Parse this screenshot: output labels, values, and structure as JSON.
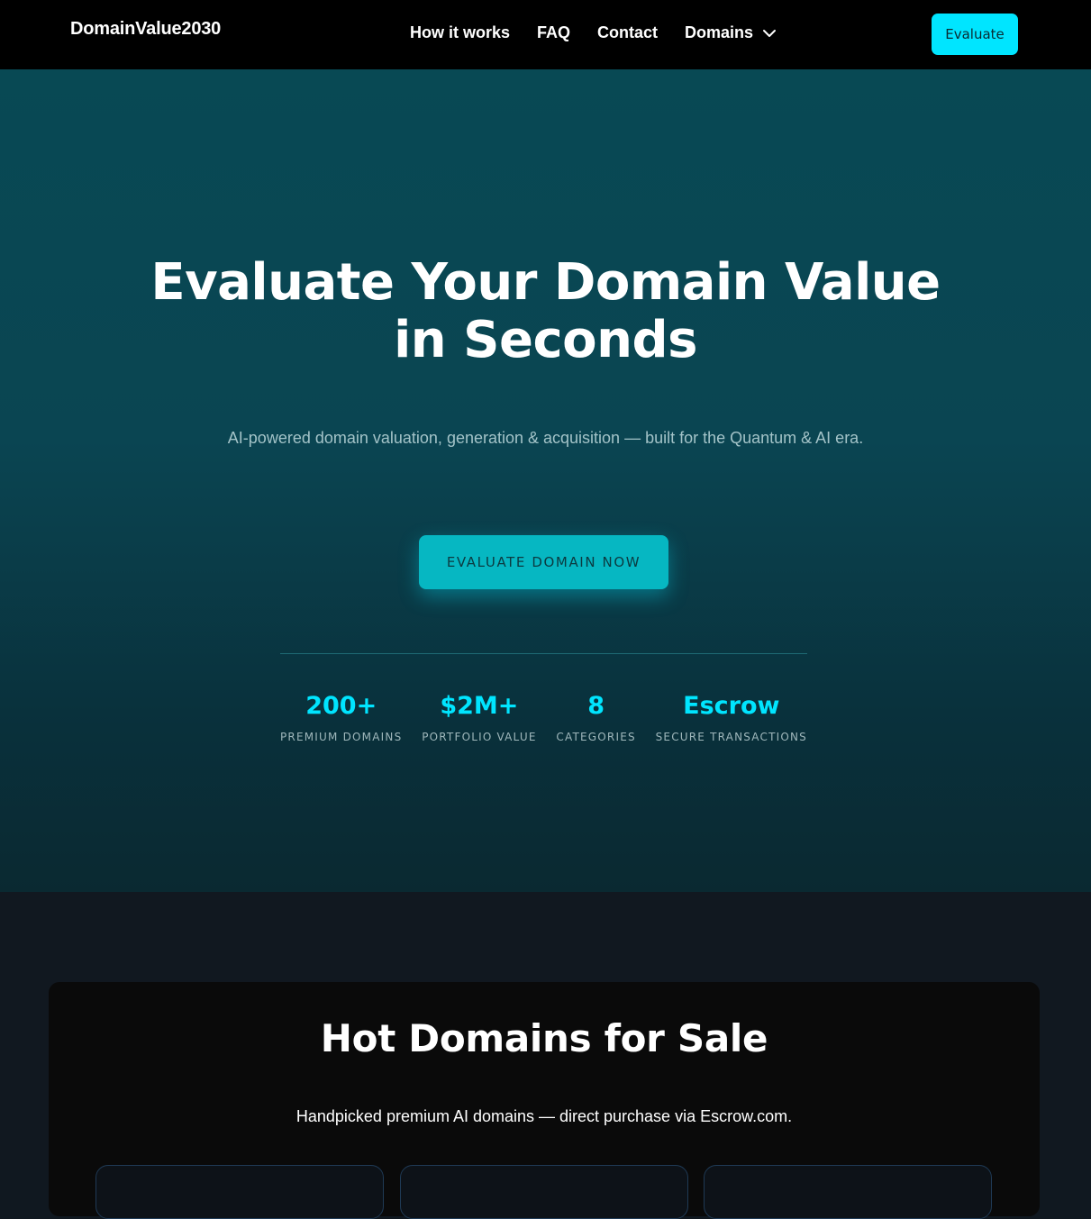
{
  "nav": {
    "brand": "DomainValue2030",
    "links": [
      "How it works",
      "FAQ",
      "Contact"
    ],
    "dropdown_label": "Domains",
    "cta_label": "Evaluate"
  },
  "hero": {
    "title": "Evaluate Your Domain Value in Seconds",
    "subtitle": "AI-powered domain valuation, generation & acquisition — built for the Quantum & AI era.",
    "cta_label": "EVALUATE DOMAIN NOW",
    "stats": [
      {
        "value": "200+",
        "label": "PREMIUM DOMAINS"
      },
      {
        "value": "$2M+",
        "label": "PORTFOLIO VALUE"
      },
      {
        "value": "8",
        "label": "CATEGORIES"
      },
      {
        "value": "Escrow",
        "label": "SECURE TRANSACTIONS"
      }
    ]
  },
  "hot_domains": {
    "title": "Hot Domains for Sale",
    "subtitle": "Handpicked premium AI domains — direct purchase via Escrow.com."
  },
  "colors": {
    "accent": "#00e5ff",
    "nav_bg": "#000000",
    "hero_top": "#084954",
    "hero_bottom": "#0a2931",
    "section_bg": "#111820",
    "card_bg": "#0a0a0a"
  },
  "icons": {
    "dropdown": "chevron-down-icon"
  }
}
